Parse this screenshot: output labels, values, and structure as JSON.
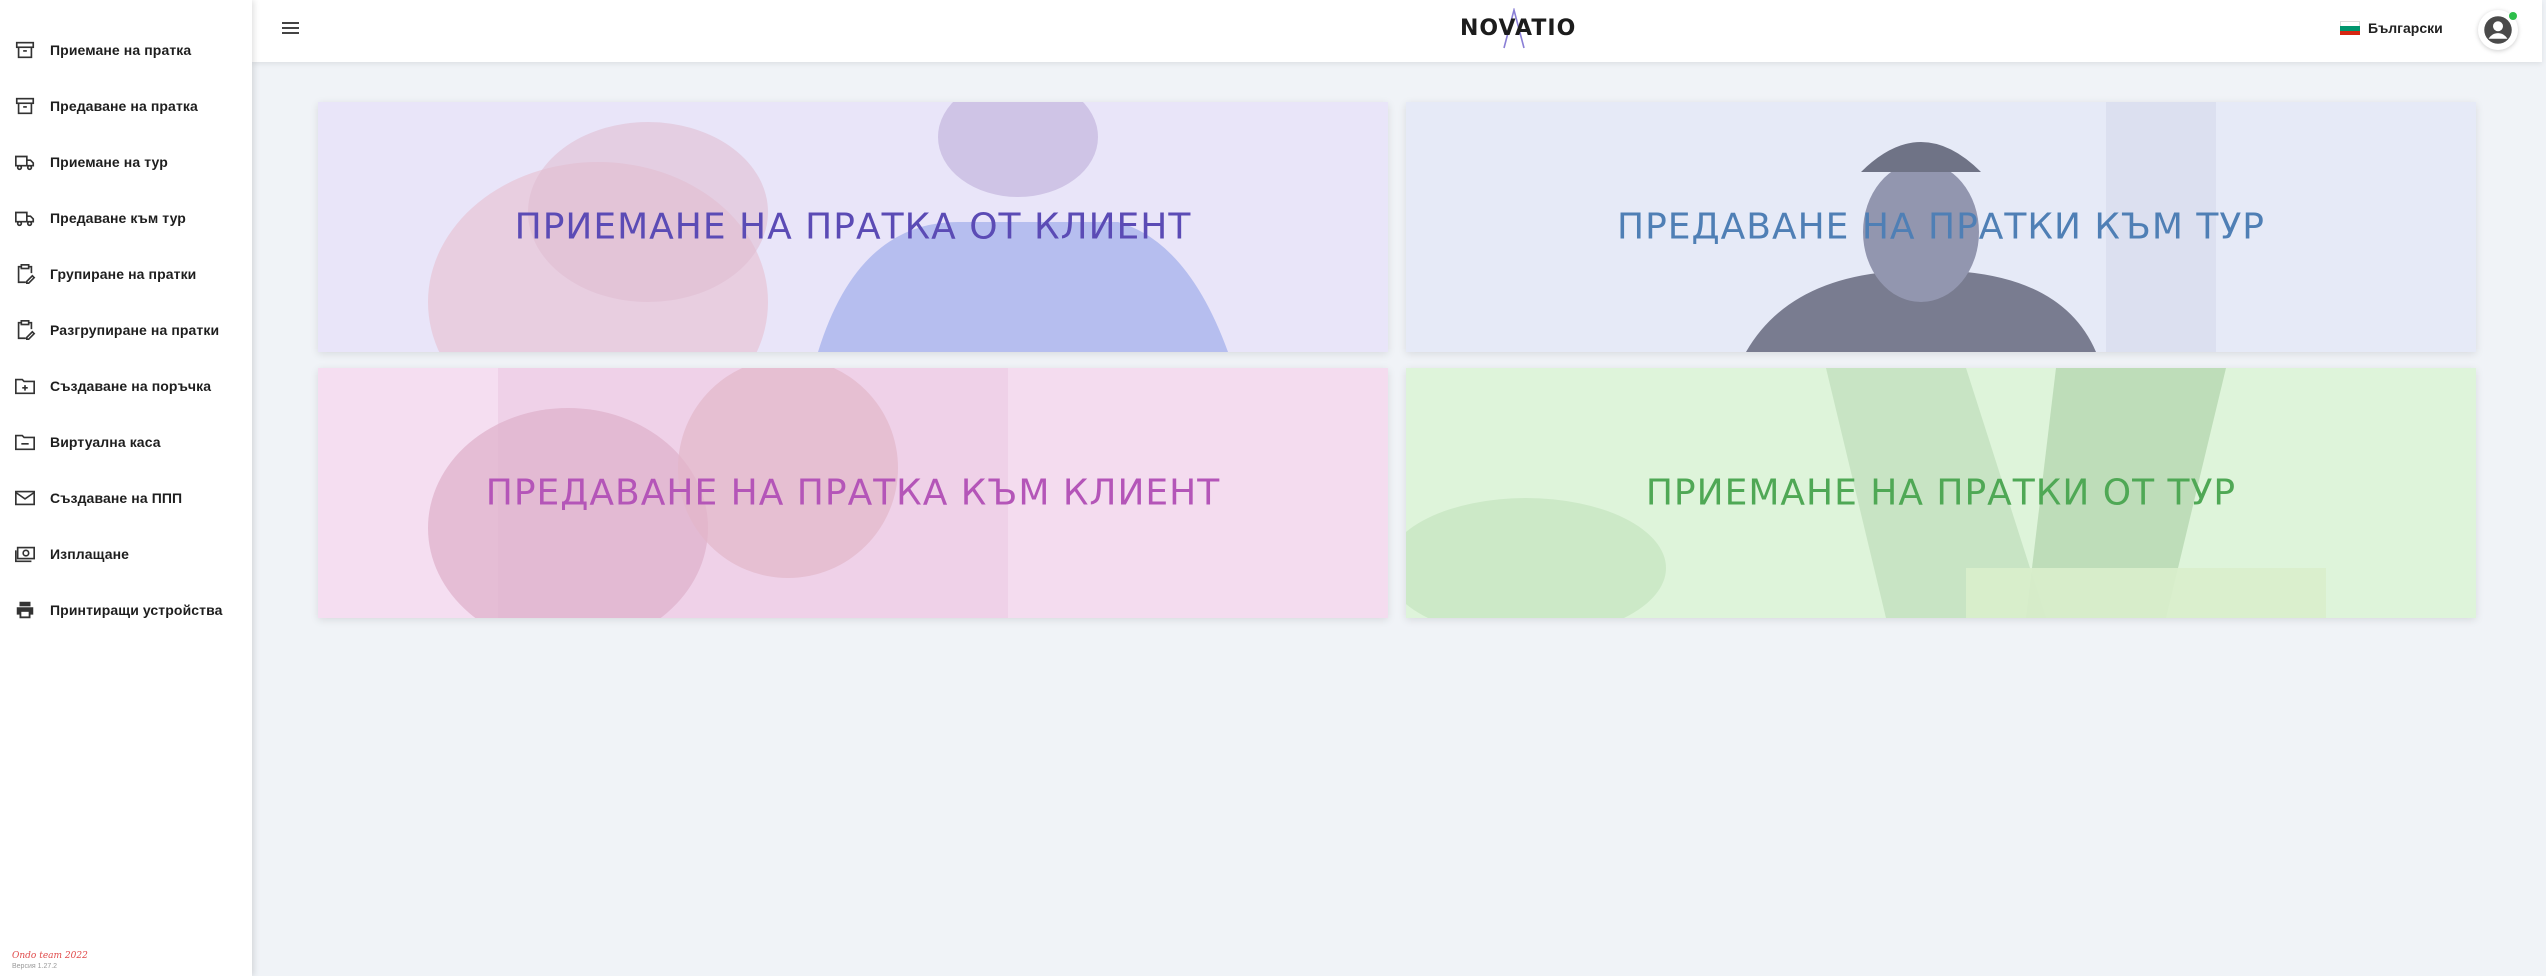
{
  "sidebar": {
    "items": [
      {
        "label": "Приемане на пратка",
        "icon": "archive-icon"
      },
      {
        "label": "Предаване на пратка",
        "icon": "archive-icon"
      },
      {
        "label": "Приемане на тур",
        "icon": "truck-icon"
      },
      {
        "label": "Предаване към тур",
        "icon": "truck-icon"
      },
      {
        "label": "Групиране на пратки",
        "icon": "clipboard-edit-icon"
      },
      {
        "label": "Разгрупиране на пратки",
        "icon": "clipboard-edit-icon"
      },
      {
        "label": "Създаване на поръчка",
        "icon": "folder-plus-icon"
      },
      {
        "label": "Виртуална каса",
        "icon": "folder-icon"
      },
      {
        "label": "Създаване на ППП",
        "icon": "envelope-icon"
      },
      {
        "label": "Изплащане",
        "icon": "cash-icon"
      },
      {
        "label": "Принтиращи устройства",
        "icon": "printer-icon"
      }
    ],
    "footer_brand": "Ondo team 2022",
    "footer_version": "Версия 1.27.2"
  },
  "header": {
    "logo": "NOVATIO",
    "language": "Български",
    "colors": {
      "flag_white": "#ffffff",
      "flag_green": "#00966e",
      "flag_red": "#d62612",
      "status": "#2dbe4a"
    }
  },
  "cards": [
    {
      "title": "ПРИЕМАНЕ НА ПРАТКА ОТ КЛИЕНТ",
      "color": "#5b4bb5"
    },
    {
      "title": "ПРЕДАВАНЕ НА ПРАТКИ КЪМ ТУР",
      "color": "#4f7fb5"
    },
    {
      "title": "ПРЕДАВАНЕ НА ПРАТКА КЪМ КЛИЕНТ",
      "color": "#b455b8"
    },
    {
      "title": "ПРИЕМАНЕ НА ПРАТКИ ОТ ТУР",
      "color": "#4fa855"
    }
  ]
}
